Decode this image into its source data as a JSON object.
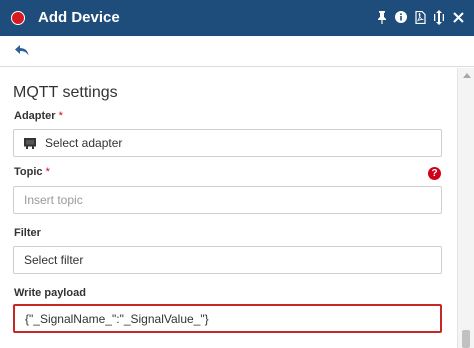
{
  "window": {
    "title": "Add Device",
    "icons": [
      "pin-icon",
      "info-icon",
      "pdf-icon",
      "resize-icon",
      "close-icon"
    ]
  },
  "toolbar": {
    "back_icon": "back-arrow-icon"
  },
  "form": {
    "section_title": "MQTT settings",
    "adapter": {
      "label": "Adapter",
      "required_mark": "*",
      "value": "Select adapter"
    },
    "topic": {
      "label": "Topic",
      "required_mark": "*",
      "placeholder": "Insert topic",
      "help_glyph": "?"
    },
    "filter": {
      "label": "Filter",
      "value": "Select filter"
    },
    "write_payload": {
      "label": "Write payload",
      "value": "{\"_SignalName_\":\"_SignalValue_\"}"
    }
  },
  "colors": {
    "titlebar": "#1e4d7b",
    "record_dot": "#d71921",
    "required": "#d0021b",
    "error_border": "#c62828"
  }
}
